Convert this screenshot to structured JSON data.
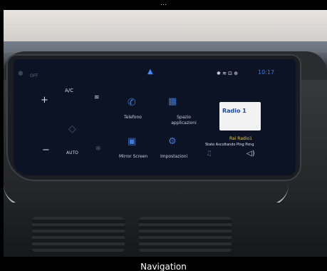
{
  "top_caption": "...",
  "bottom_caption": "Navigation",
  "climate": {
    "off_label": "OFF",
    "ac_label": "A/C",
    "auto_label": "AUTO",
    "plus": "+",
    "minus": "−"
  },
  "apps": [
    {
      "label": "Telefono"
    },
    {
      "label": "Spazio applicazioni"
    },
    {
      "label": "Mirror Screen"
    },
    {
      "label": "Impostazioni"
    }
  ],
  "status": {
    "time": "10:17"
  },
  "media": {
    "station": "Rai Radio1",
    "now_playing": "Stato Ascoltando Ping Pong",
    "logo_text": "Radio 1"
  }
}
